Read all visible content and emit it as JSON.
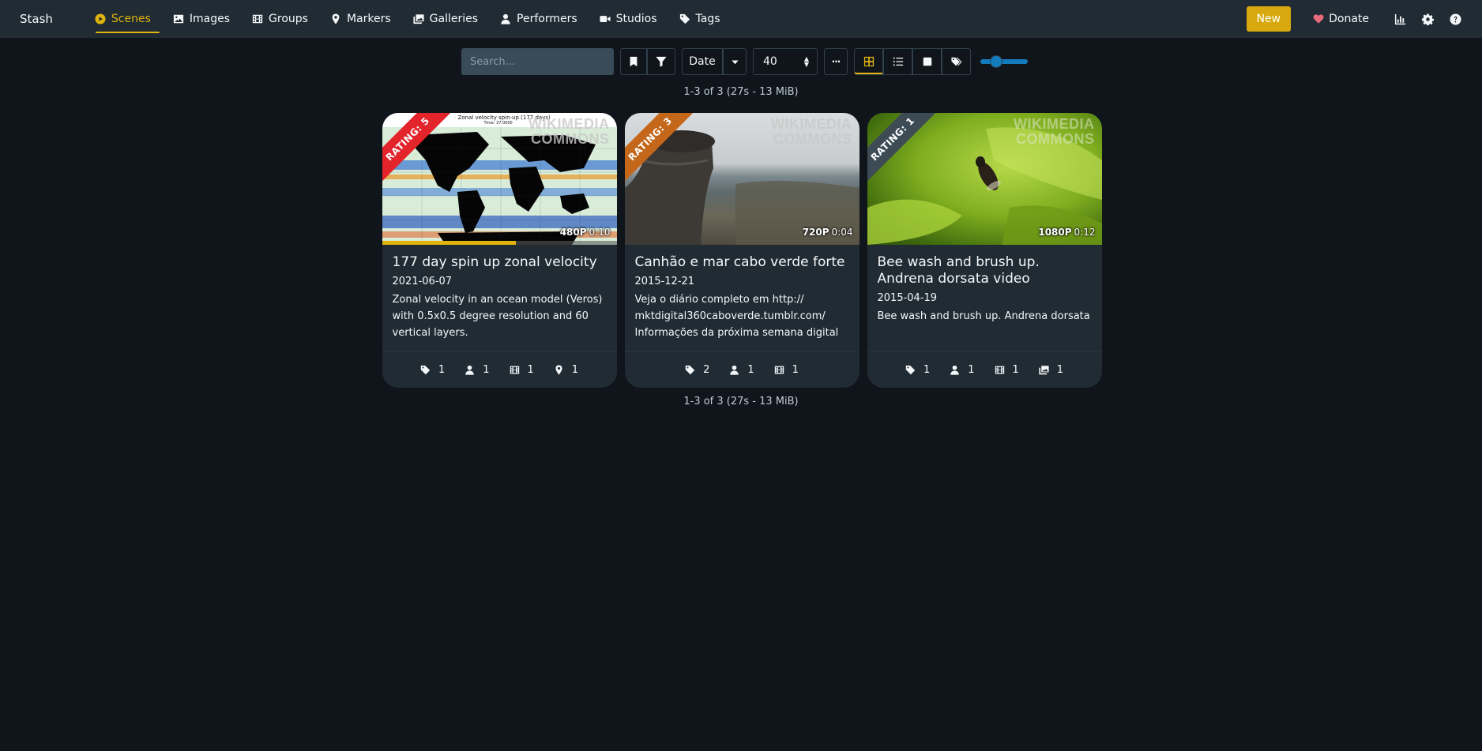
{
  "nav": {
    "brand": "Stash",
    "items": [
      {
        "label": "Scenes",
        "icon": "play-circle-icon"
      },
      {
        "label": "Images",
        "icon": "image-icon"
      },
      {
        "label": "Groups",
        "icon": "film-icon"
      },
      {
        "label": "Markers",
        "icon": "map-marker-icon"
      },
      {
        "label": "Galleries",
        "icon": "images-icon"
      },
      {
        "label": "Performers",
        "icon": "user-icon"
      },
      {
        "label": "Studios",
        "icon": "video-icon"
      },
      {
        "label": "Tags",
        "icon": "tag-icon"
      }
    ],
    "active": "Scenes",
    "new_label": "New",
    "donate_label": "Donate"
  },
  "toolbar": {
    "search_placeholder": "Search...",
    "sort_by": "Date",
    "per_page": "40",
    "more": "···"
  },
  "results": {
    "count_text": "1-3 of 3 (27s - 13 MiB)"
  },
  "scenes": [
    {
      "title": "177 day spin up zonal velocity",
      "date": "2021-06-07",
      "description": "Zonal velocity in an ocean model (Veros) with 0.5x0.5 degree resolution and 60 vertical layers.",
      "rating": "RATING: 5",
      "rating_color": "#e3242b",
      "resolution": "480P",
      "duration": "0:10",
      "progress": 0.57,
      "watermark": "WIKIMEDIA COMMONS",
      "thumb_caption": "Zonal velocity spin-up (177 days)",
      "thumb_time": "Time: 37.0000",
      "counts": {
        "tags": "1",
        "performers": "1",
        "groups": "1",
        "markers": "1"
      }
    },
    {
      "title": "Canhão e mar cabo verde forte",
      "date": "2015-12-21",
      "description": "Veja o diário completo em http:// mktdigital360caboverde.tumblr.com/ Informações da próxima semana digital já...",
      "rating": "RATING: 3",
      "rating_color": "#c4671a",
      "resolution": "720P",
      "duration": "0:04",
      "watermark": "WIKIMEDIA COMMONS",
      "counts": {
        "tags": "2",
        "performers": "1",
        "groups": "1"
      }
    },
    {
      "title": "Bee wash and brush up. Andrena dorsata video",
      "date": "2015-04-19",
      "description": "Bee wash and brush up. Andrena dorsata",
      "rating": "RATING: 1",
      "rating_color": "#3d4b55",
      "resolution": "1080P",
      "duration": "0:12",
      "watermark": "WIKIMEDIA COMMONS",
      "counts": {
        "tags": "1",
        "performers": "1",
        "groups": "1",
        "galleries": "1"
      }
    }
  ]
}
